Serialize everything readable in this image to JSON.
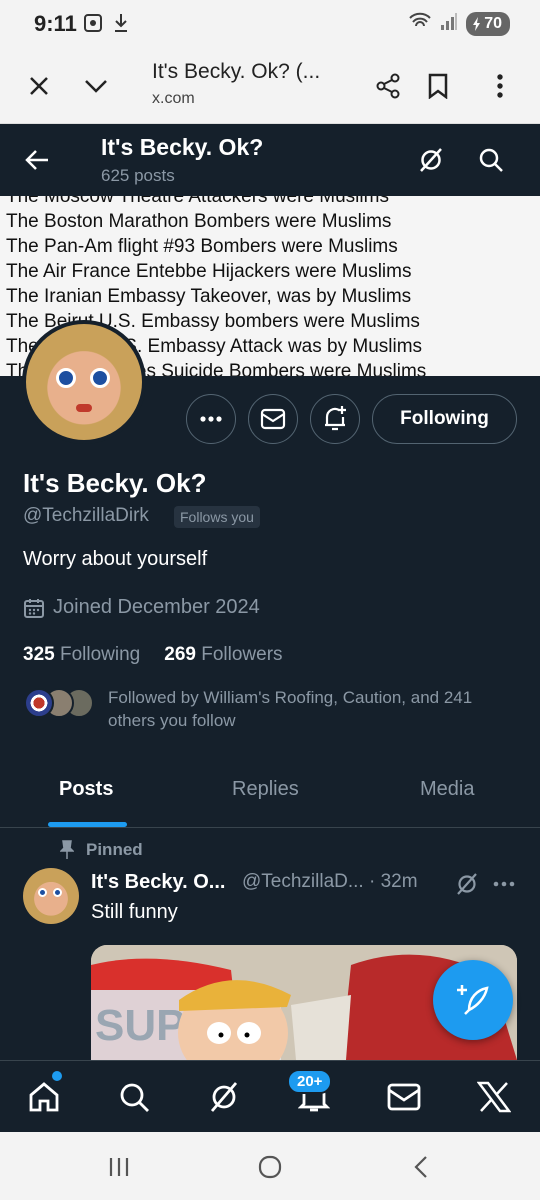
{
  "status_bar": {
    "time": "9:11",
    "battery": "70",
    "icons": [
      "screenshot-icon",
      "download-icon",
      "wifi-icon",
      "signal-icon",
      "battery-icon"
    ]
  },
  "browser": {
    "title": "It's Becky. Ok? (...",
    "domain": "x.com"
  },
  "header": {
    "name": "It's Becky. Ok?",
    "posts_count": "625 posts"
  },
  "banner": {
    "lines": [
      "The Moscow Theatre Attackers were Muslims",
      "The Boston Marathon Bombers were Muslims",
      "The Pan-Am flight #93 Bombers were Muslims",
      "The Air France Entebbe Hijackers were Muslims",
      "The Iranian Embassy Takeover, was by Muslims",
      "The Beirut U.S. Embassy bombers were Muslims",
      "The Libyan U.S. Embassy Attack was by Muslims",
      "The Buenos Aires Suicide Bombers were Muslims"
    ]
  },
  "profile": {
    "name": "It's Becky. Ok?",
    "handle": "@TechzillaDirk",
    "follows_you": "Follows you",
    "bio": "Worry about yourself",
    "joined": "Joined December 2024",
    "following_count": "325",
    "following_label": "Following",
    "followers_count": "269",
    "followers_label": "Followers",
    "followed_by": "Followed by William's Roofing, Caution, and 241 others you follow",
    "following_button": "Following"
  },
  "tabs": [
    {
      "label": "Posts",
      "active": true
    },
    {
      "label": "Replies",
      "active": false
    },
    {
      "label": "Media",
      "active": false
    }
  ],
  "post": {
    "pinned_label": "Pinned",
    "author": "It's Becky. O...",
    "handle_time": "@TechzillaD... · 32m",
    "text": "Still funny"
  },
  "bottom_nav": {
    "notifications_badge": "20+"
  },
  "colors": {
    "background": "#15202b",
    "accent": "#1d9bf0",
    "muted": "#8b98a5",
    "border": "#38444d"
  }
}
